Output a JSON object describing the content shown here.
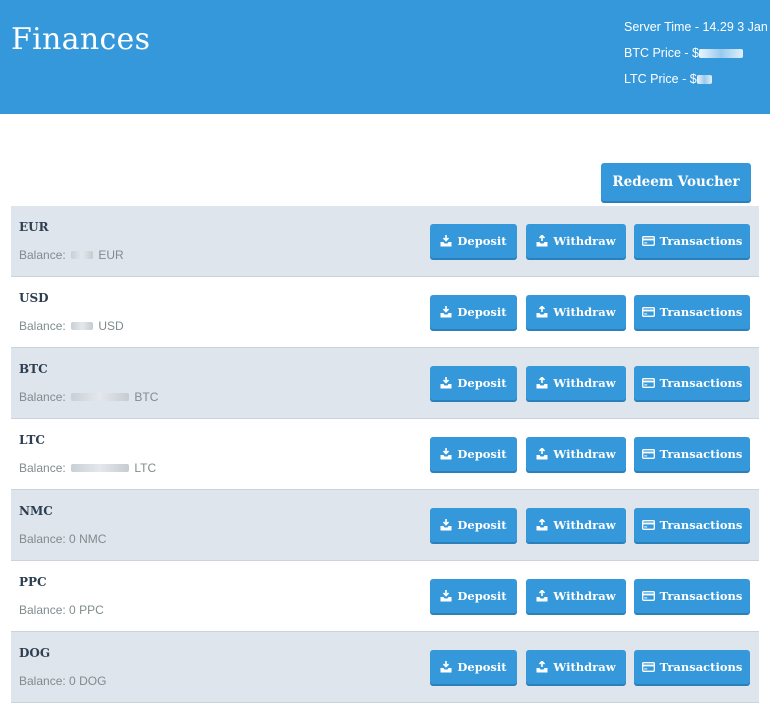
{
  "header": {
    "title": "Finances",
    "server_time": "Server Time - 14.29 3 Jan",
    "btc_price_prefix": "BTC Price - $",
    "ltc_price_prefix": "LTC Price - $"
  },
  "actions": {
    "redeem_label": "Redeem Voucher",
    "deposit_label": "Deposit",
    "withdraw_label": "Withdraw",
    "transactions_label": "Transactions"
  },
  "balance_prefix": "Balance:",
  "currencies": [
    {
      "code": "EUR",
      "unit": "EUR",
      "amount": ""
    },
    {
      "code": "USD",
      "unit": "USD",
      "amount": ""
    },
    {
      "code": "BTC",
      "unit": "BTC",
      "amount": ""
    },
    {
      "code": "LTC",
      "unit": "LTC",
      "amount": ""
    },
    {
      "code": "NMC",
      "unit": "NMC",
      "amount": "0"
    },
    {
      "code": "PPC",
      "unit": "PPC",
      "amount": "0"
    },
    {
      "code": "DOG",
      "unit": "DOG",
      "amount": "0"
    }
  ],
  "colors": {
    "header_bg": "#3498db",
    "button_bg": "#3498db",
    "row_shade": "#dfe5ec"
  },
  "icons": {
    "deposit": "inbox-download-icon",
    "withdraw": "inbox-upload-icon",
    "transactions": "credit-card-icon"
  }
}
